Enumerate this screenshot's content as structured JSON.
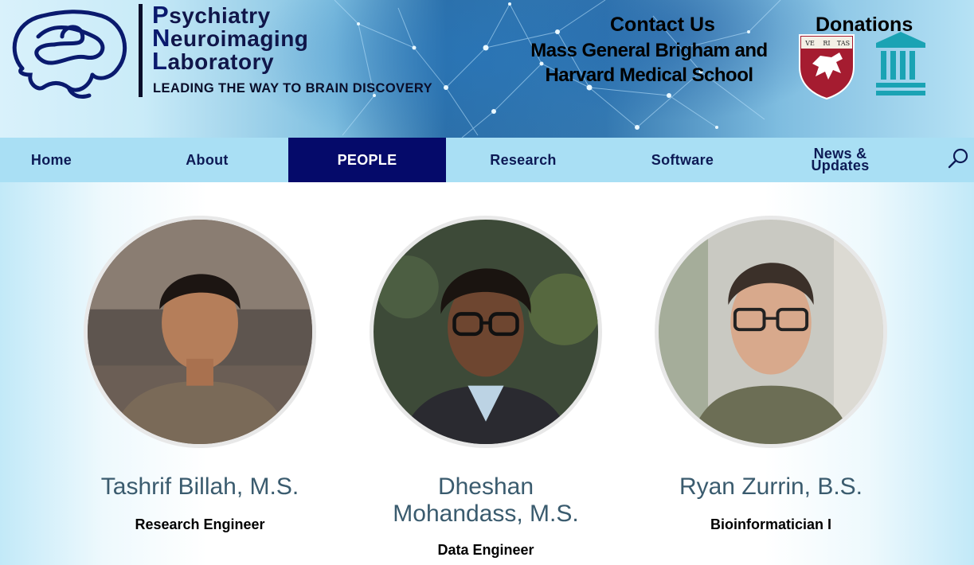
{
  "header": {
    "lab_name_lines": [
      {
        "initial": "P",
        "rest": "sychiatry"
      },
      {
        "initial": "N",
        "rest": "euroimaging"
      },
      {
        "initial": "L",
        "rest": "aboratory"
      }
    ],
    "tagline": "LEADING THE WAY TO BRAIN DISCOVERY",
    "contact_label": "Contact Us",
    "institution_line1": "Mass General Brigham and",
    "institution_line2": "Harvard Medical School",
    "donations_label": "Donations",
    "shield_text": [
      "VE",
      "RI",
      "TAS"
    ]
  },
  "nav": {
    "items": [
      {
        "label": "Home"
      },
      {
        "label": "About"
      },
      {
        "label": "PEOPLE",
        "active": true
      },
      {
        "label": "Research"
      },
      {
        "label": "Software"
      },
      {
        "label_line1": "News &",
        "label_line2": "Updates"
      }
    ],
    "search_icon": "search-icon"
  },
  "people": [
    {
      "name": "Tashrif Billah, M.S.",
      "role": "Research Engineer"
    },
    {
      "name_line1": "Dheshan",
      "name_line2": "Mohandass, M.S.",
      "role": "Data Engineer"
    },
    {
      "name": "Ryan Zurrin, B.S.",
      "role": "Bioinformatician I"
    }
  ],
  "colors": {
    "nav_bg": "#a9dff4",
    "nav_active_bg": "#050a6a",
    "nav_text": "#0d1a55",
    "name_text": "#3a5b6e",
    "harvard_crimson": "#a51c30",
    "mgb_teal": "#1aa3b4"
  }
}
